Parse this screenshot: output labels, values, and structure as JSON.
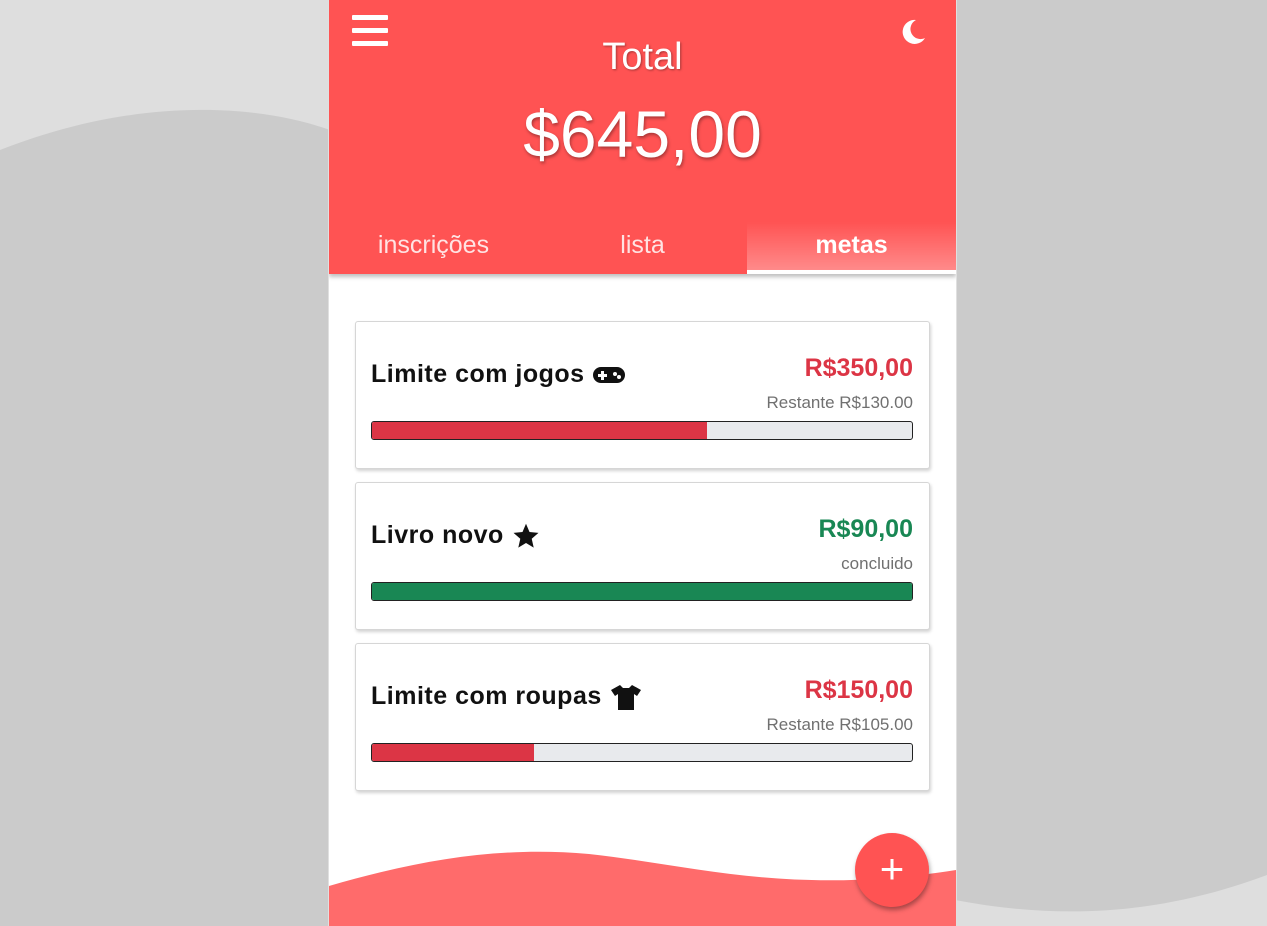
{
  "header": {
    "title": "Total",
    "total": "$645,00"
  },
  "tabs": [
    {
      "label": "inscrições",
      "active": false
    },
    {
      "label": "lista",
      "active": false
    },
    {
      "label": "metas",
      "active": true
    }
  ],
  "goals": [
    {
      "title": "Limite com jogos",
      "icon": "gamepad-icon",
      "amount": "R$350,00",
      "subtext": "Restante R$130.00",
      "progress_percent": 62,
      "status_color": "#dc3545"
    },
    {
      "title": "Livro novo",
      "icon": "star-icon",
      "amount": "R$90,00",
      "subtext": "concluido",
      "progress_percent": 100,
      "status_color": "#198754"
    },
    {
      "title": "Limite com roupas",
      "icon": "shirt-icon",
      "amount": "R$150,00",
      "subtext": "Restante R$105.00",
      "progress_percent": 30,
      "status_color": "#dc3545"
    }
  ],
  "fab": {
    "label": "+"
  },
  "colors": {
    "brand": "#ff5353",
    "danger": "#dc3545",
    "success": "#198754",
    "background": "#cbcbcb"
  }
}
